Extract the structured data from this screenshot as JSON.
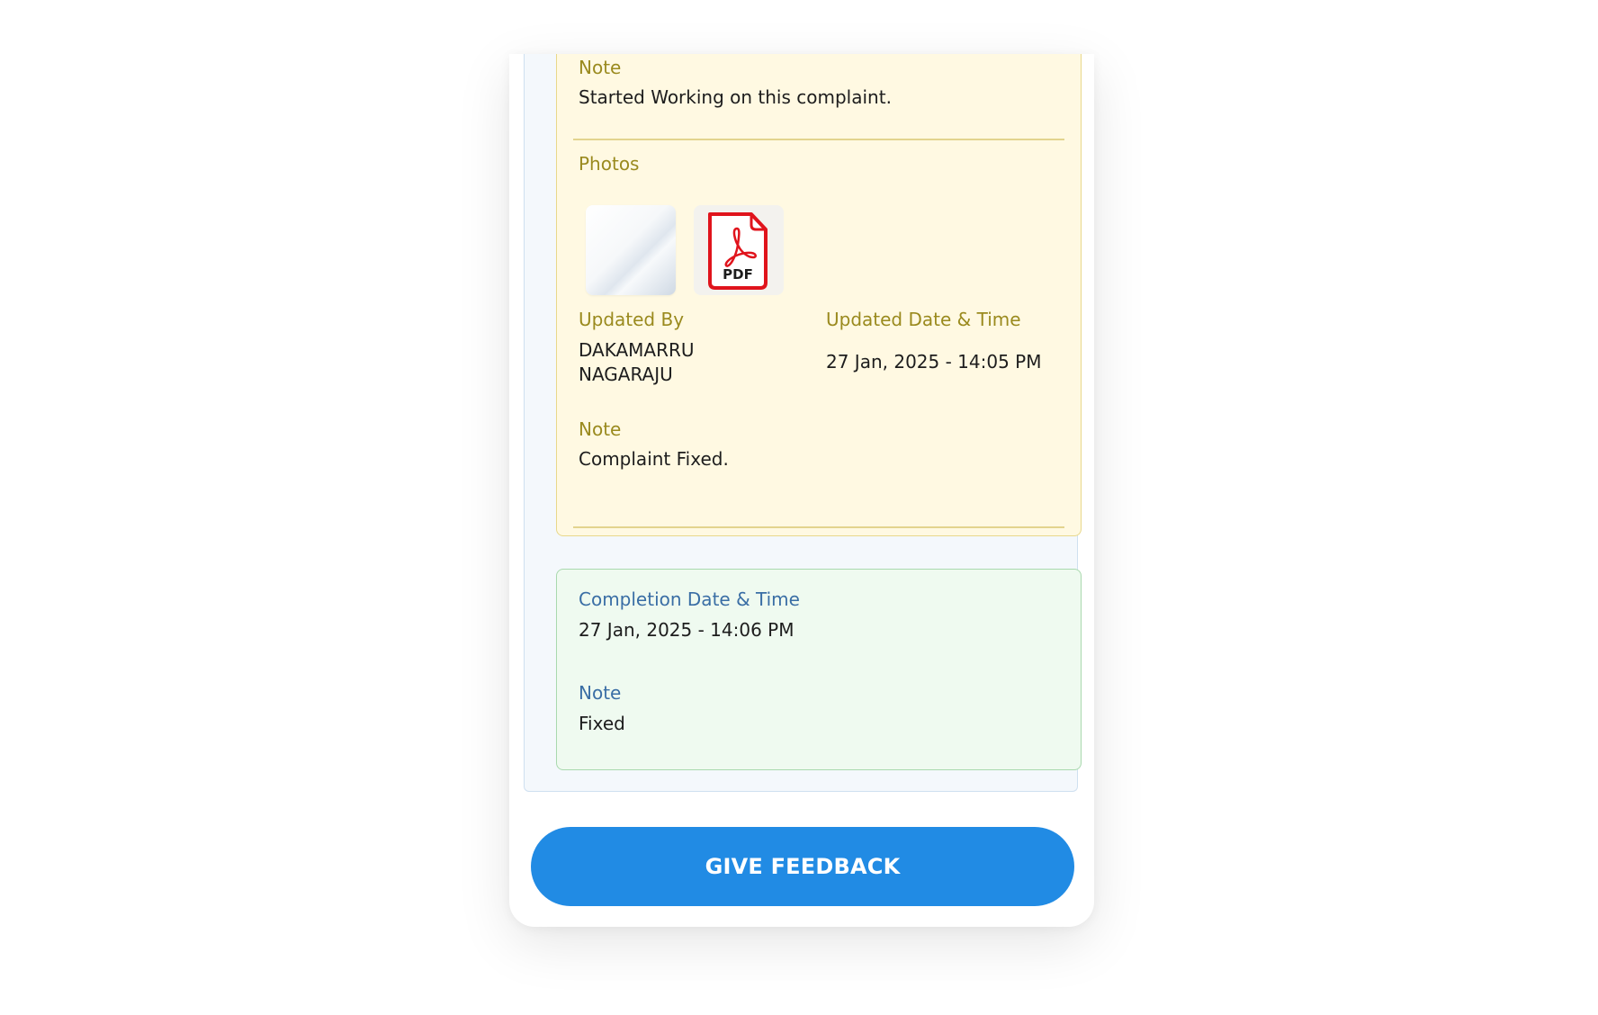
{
  "updates": {
    "first_note": {
      "label": "Note",
      "value": "Started Working on this complaint."
    },
    "photos_label": "Photos",
    "photos": [
      {
        "type": "image",
        "icon": "photo-thumbnail"
      },
      {
        "type": "pdf",
        "icon": "pdf-file-icon",
        "badge": "PDF"
      }
    ],
    "updated_by": {
      "label": "Updated By",
      "value_line1": "DAKAMARRU",
      "value_line2": "NAGARAJU"
    },
    "updated_datetime": {
      "label": "Updated Date & Time",
      "value": "27 Jan, 2025 - 14:05 PM"
    },
    "second_note": {
      "label": "Note",
      "value": "Complaint Fixed."
    }
  },
  "completion": {
    "datetime_label": "Completion Date & Time",
    "datetime_value": "27 Jan, 2025 - 14:06 PM",
    "note_label": "Note",
    "note_value": "Fixed"
  },
  "actions": {
    "feedback_label": "GIVE FEEDBACK"
  },
  "colors": {
    "accent": "#218be4",
    "update_panel_bg": "#fff9e2",
    "completion_panel_bg": "#effaf0",
    "update_label": "#9a8a1e",
    "completion_label": "#3a6ea5"
  }
}
